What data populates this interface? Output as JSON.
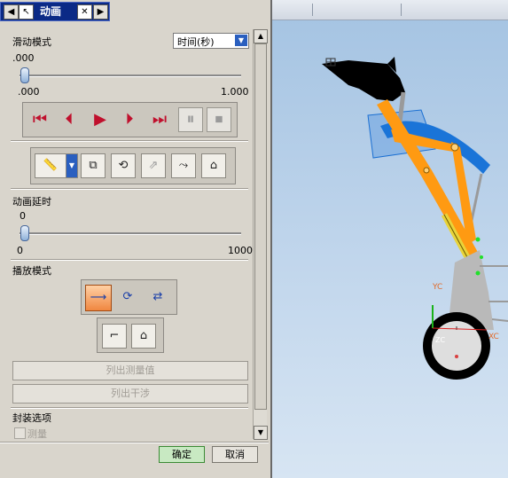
{
  "window": {
    "title": "动画"
  },
  "slider_mode": {
    "label": "滑动模式",
    "dropdown_value": "时间(秒)",
    "current": ".000",
    "min_label": ".000",
    "max_label": "1.000",
    "position_fraction": 0
  },
  "playback_buttons": [
    "first-frame",
    "step-back",
    "play",
    "step-forward",
    "last-frame",
    "pause",
    "stop"
  ],
  "tools": [
    "measure",
    "trace",
    "interference",
    "explode",
    "assembly-constraint",
    "export"
  ],
  "animation_delay": {
    "label": "动画延时",
    "current": "0",
    "min_label": "0",
    "max_label": "1000",
    "position_fraction": 0
  },
  "play_mode": {
    "label": "播放模式",
    "options": [
      "play-once",
      "loop",
      "back-and-forth"
    ],
    "selected": "play-once"
  },
  "buttons": {
    "list_measure": "列出测量值",
    "list_interference": "列出干涉",
    "ok": "确定",
    "cancel": "取消"
  },
  "package_options": {
    "label": "封装选项",
    "measure_checkbox": "测量",
    "measure_checked": false
  },
  "viewport": {
    "axis_y_label": "YC",
    "axis_x_label": "XC",
    "axis_z_label": "ZC",
    "colors": {
      "arm": "#ff9a12",
      "blade": "#1a6fd2",
      "body": "#000000",
      "support": "#b9b9b9"
    }
  }
}
